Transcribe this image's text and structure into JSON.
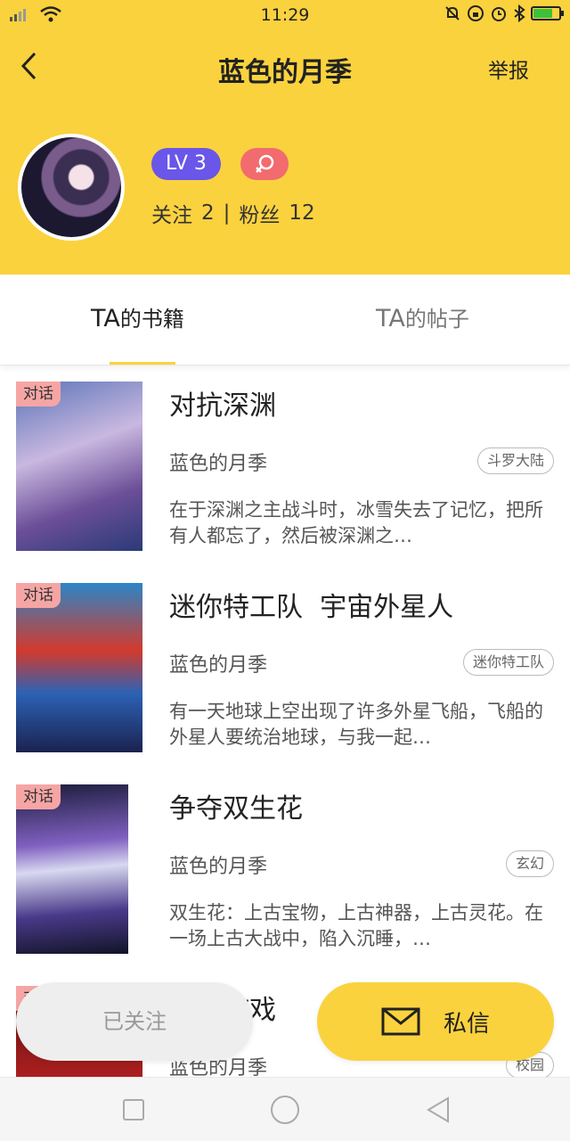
{
  "status_bar": {
    "time": "11:29",
    "battery_level": 0.75
  },
  "header": {
    "title": "蓝色的月季",
    "report_label": "举报"
  },
  "profile": {
    "level": "LV 3",
    "following_label": "关注",
    "following_count": "2",
    "separator": "|",
    "fans_label": "粉丝",
    "fans_count": "12"
  },
  "tabs": [
    {
      "label_prefix": "TA",
      "label_suffix": "的书籍",
      "active": true
    },
    {
      "label_prefix": "TA",
      "label_suffix": "的帖子",
      "active": false
    }
  ],
  "books": [
    {
      "tag": "对话",
      "title": "对抗深渊",
      "author": "蓝色的月季",
      "category": "斗罗大陆",
      "description": "在于深渊之主战斗时，冰雪失去了记忆，把所有人都忘了，然后被深渊之…"
    },
    {
      "tag": "对话",
      "title": "迷你特工队  宇宙外星人",
      "author": "蓝色的月季",
      "category": "迷你特工队",
      "description": "有一天地球上空出现了许多外星飞船，飞船的外星人要统治地球，与我一起…"
    },
    {
      "tag": "对话",
      "title": "争夺双生花",
      "author": "蓝色的月季",
      "category": "玄幻",
      "description": "双生花：上古宝物，上古神器，上古灵花。在一场上古大战中，陷入沉睡，…"
    },
    {
      "tag": "对话",
      "title": "惊魂游戏",
      "author": "蓝色的月季",
      "category": "校园",
      "description": ""
    }
  ],
  "actions": {
    "follow_label": "已关注",
    "message_label": "私信"
  },
  "colors": {
    "brand_yellow": "#fad23e",
    "level_badge": "#6a56e8",
    "gender_badge": "#f26b6e",
    "tag_pink": "#f6a5a5"
  }
}
